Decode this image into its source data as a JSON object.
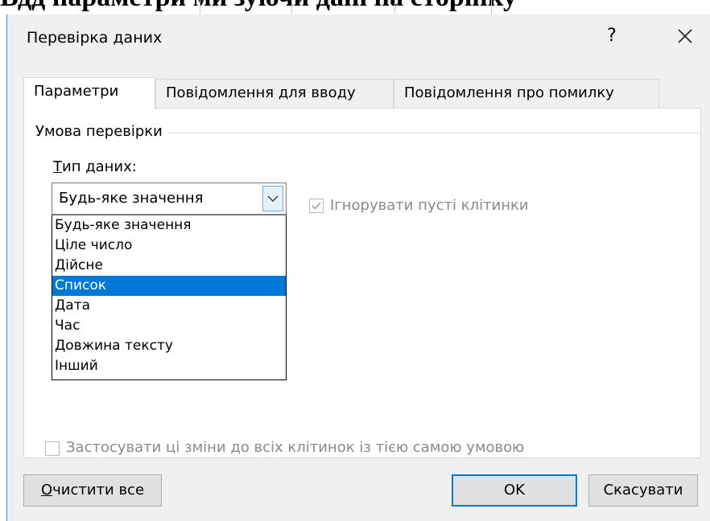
{
  "background": {
    "fragment": "Вдд параметри ми зуючи дані на сторінку"
  },
  "dialog": {
    "title": "Перевірка даних",
    "help_label": "?",
    "close_label": "✕"
  },
  "tabs": [
    {
      "label": "Параметри",
      "active": true
    },
    {
      "label": "Повідомлення для вводу",
      "active": false
    },
    {
      "label": "Повідомлення про помилку",
      "active": false
    }
  ],
  "settings": {
    "group_title": "Умова перевірки",
    "data_type_label_first": "Т",
    "data_type_label_rest": "ип даних:",
    "data_type_value": "Будь-яке значення",
    "ignore_blank_label": "Ігнорувати пусті клітинки",
    "ignore_blank_checked": true,
    "apply_all_label": "Застосувати ці зміни до всіх клітинок із тією самою умовою",
    "apply_all_checked": false
  },
  "dropdown": {
    "options": [
      "Будь-яке значення",
      "Ціле число",
      "Дійсне",
      "Список",
      "Дата",
      "Час",
      "Довжина тексту",
      "Інший"
    ],
    "highlighted": "Список"
  },
  "buttons": {
    "clear_first": "О",
    "clear_rest": "чистити все",
    "ok": "OK",
    "cancel": "Скасувати"
  },
  "colors": {
    "accent": "#0078d7",
    "dialog_bg": "#f0f0f0"
  }
}
